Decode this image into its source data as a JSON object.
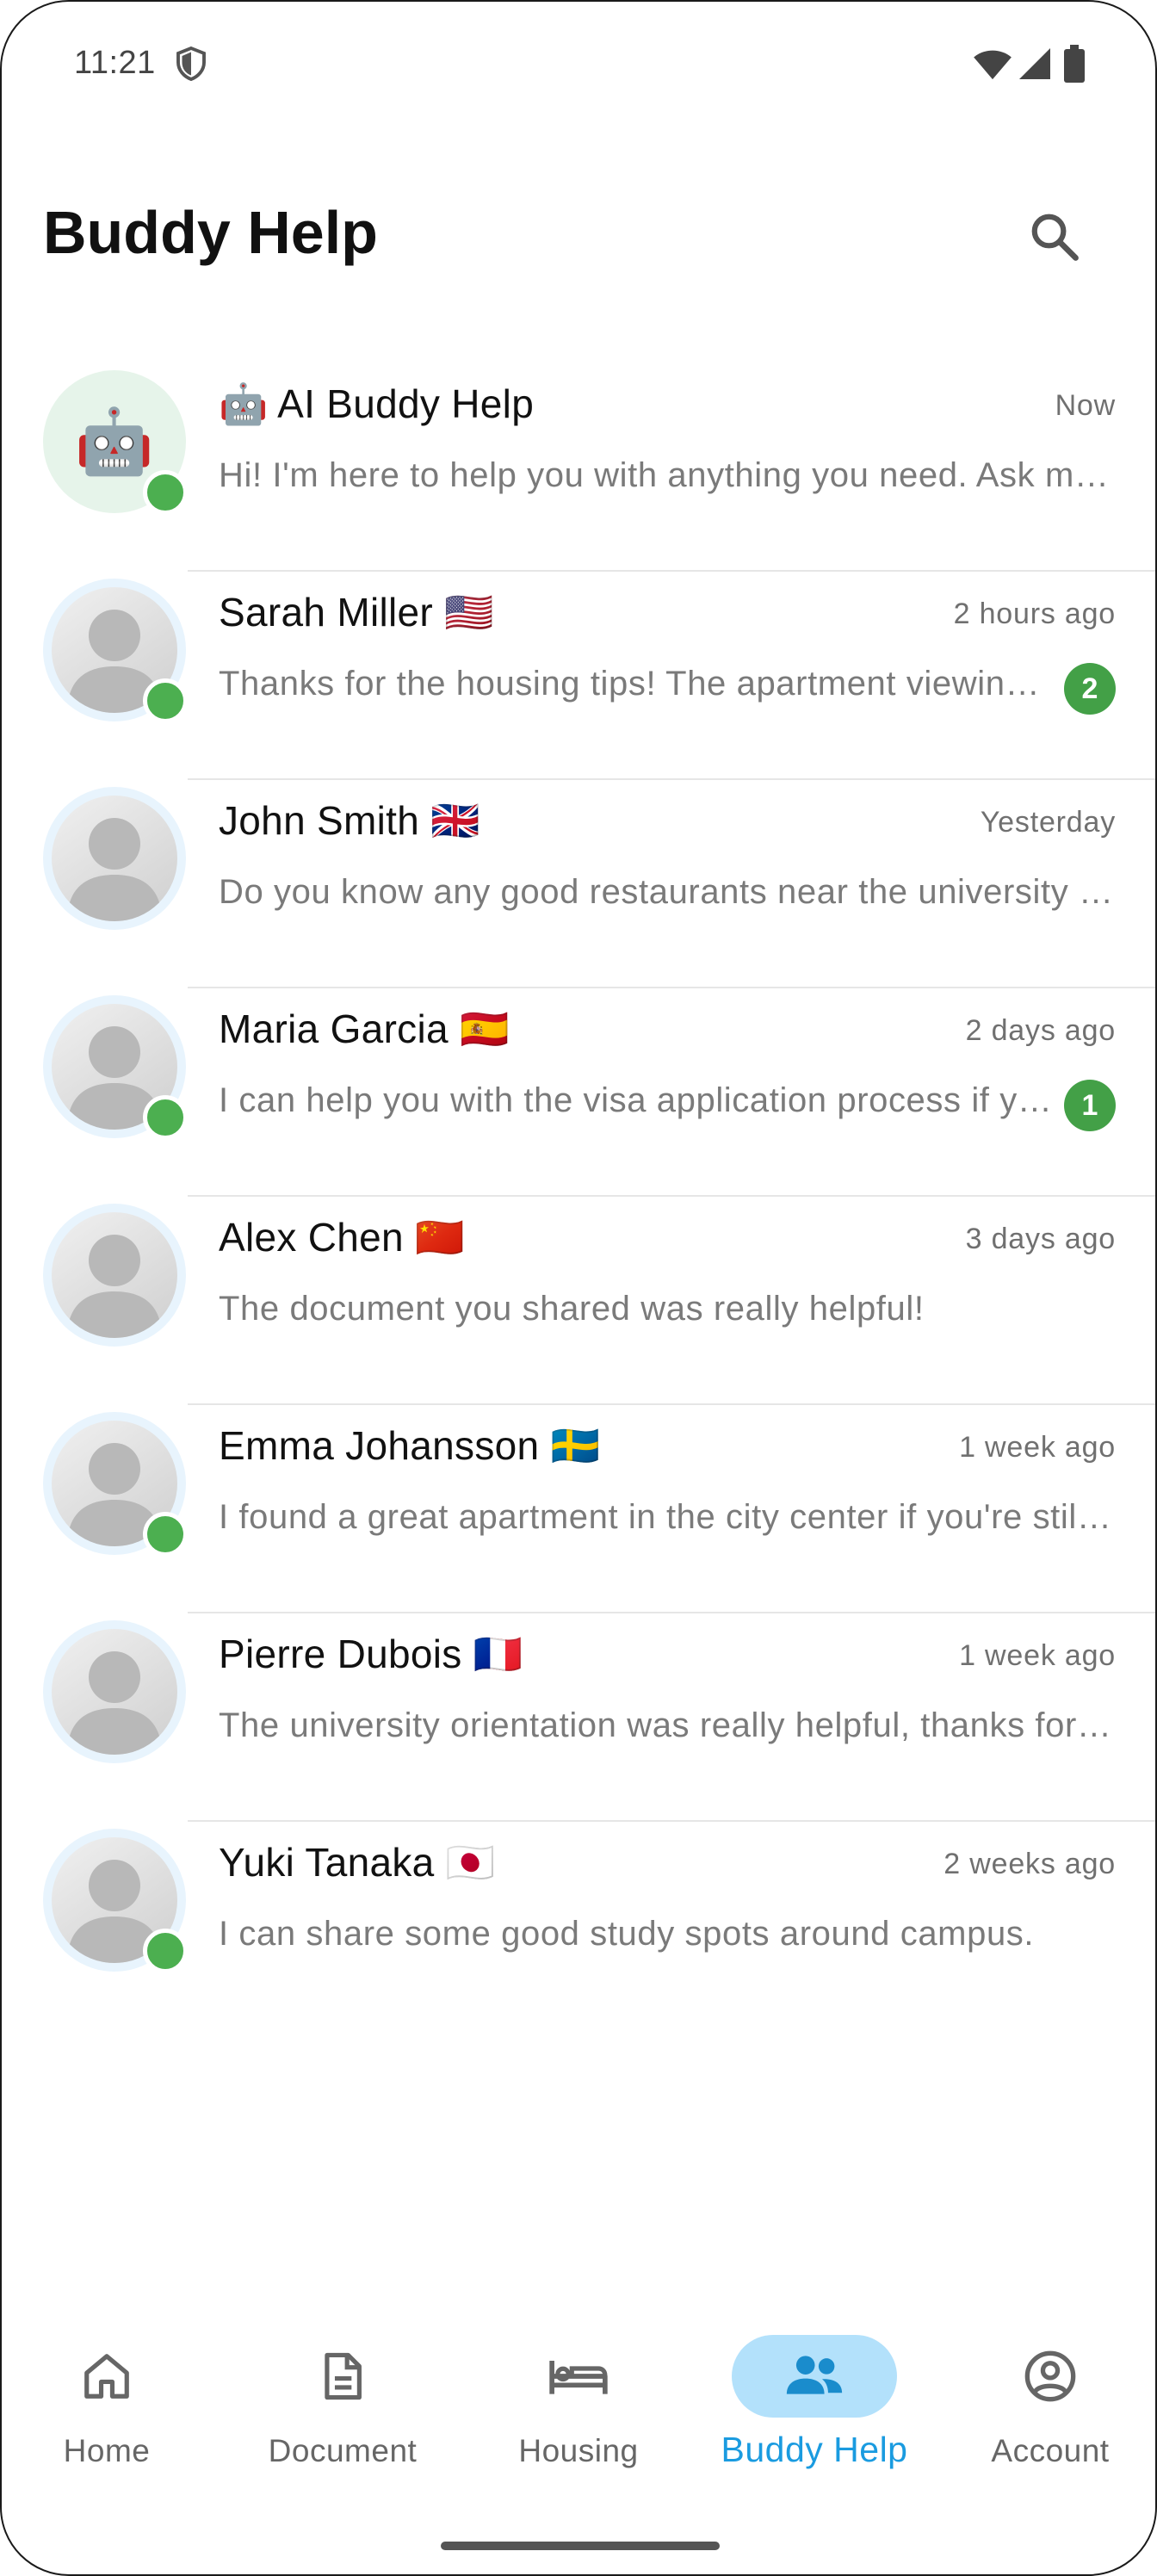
{
  "status_bar": {
    "time": "11:21"
  },
  "header": {
    "title": "Buddy Help"
  },
  "conversations": [
    {
      "name": "🤖 AI Buddy Help",
      "time": "Now",
      "preview": "Hi! I'm here to help you with anything you need. Ask me about housing, documents, restaurants or university life.",
      "badge": "",
      "online": true,
      "ai": true
    },
    {
      "name": "Sarah Miller 🇺🇸",
      "time": "2 hours ago",
      "preview": "Thanks for the housing tips! The apartment viewing went really well.",
      "badge": "2",
      "online": true,
      "ai": false
    },
    {
      "name": "John Smith 🇬🇧",
      "time": "Yesterday",
      "preview": "Do you know any good restaurants near the university campus?",
      "badge": "",
      "online": false,
      "ai": false
    },
    {
      "name": "Maria Garcia 🇪🇸",
      "time": "2 days ago",
      "preview": "I can help you with the visa application process if you need.",
      "badge": "1",
      "online": true,
      "ai": false
    },
    {
      "name": "Alex Chen 🇨🇳",
      "time": "3 days ago",
      "preview": "The document you shared was really helpful!",
      "badge": "",
      "online": false,
      "ai": false
    },
    {
      "name": "Emma Johansson 🇸🇪",
      "time": "1 week ago",
      "preview": "I found a great apartment in the city center if you're still looking.",
      "badge": "",
      "online": true,
      "ai": false
    },
    {
      "name": "Pierre Dubois 🇫🇷",
      "time": "1 week ago",
      "preview": "The university orientation was really helpful, thanks for the advice!",
      "badge": "",
      "online": false,
      "ai": false
    },
    {
      "name": "Yuki Tanaka 🇯🇵",
      "time": "2 weeks ago",
      "preview": "I can share some good study spots around campus.",
      "badge": "",
      "online": true,
      "ai": false
    }
  ],
  "bottom_nav": {
    "items": [
      {
        "label": "Home",
        "icon": "home-icon",
        "active": false
      },
      {
        "label": "Document",
        "icon": "document-icon",
        "active": false
      },
      {
        "label": "Housing",
        "icon": "bed-icon",
        "active": false
      },
      {
        "label": "Buddy Help",
        "icon": "people-icon",
        "active": true
      },
      {
        "label": "Account",
        "icon": "account-circle-icon",
        "active": false
      }
    ]
  },
  "colors": {
    "accent": "#1a9be0",
    "active_pill": "#b3e1fb",
    "online": "#4caf50",
    "badge": "#43a047"
  }
}
